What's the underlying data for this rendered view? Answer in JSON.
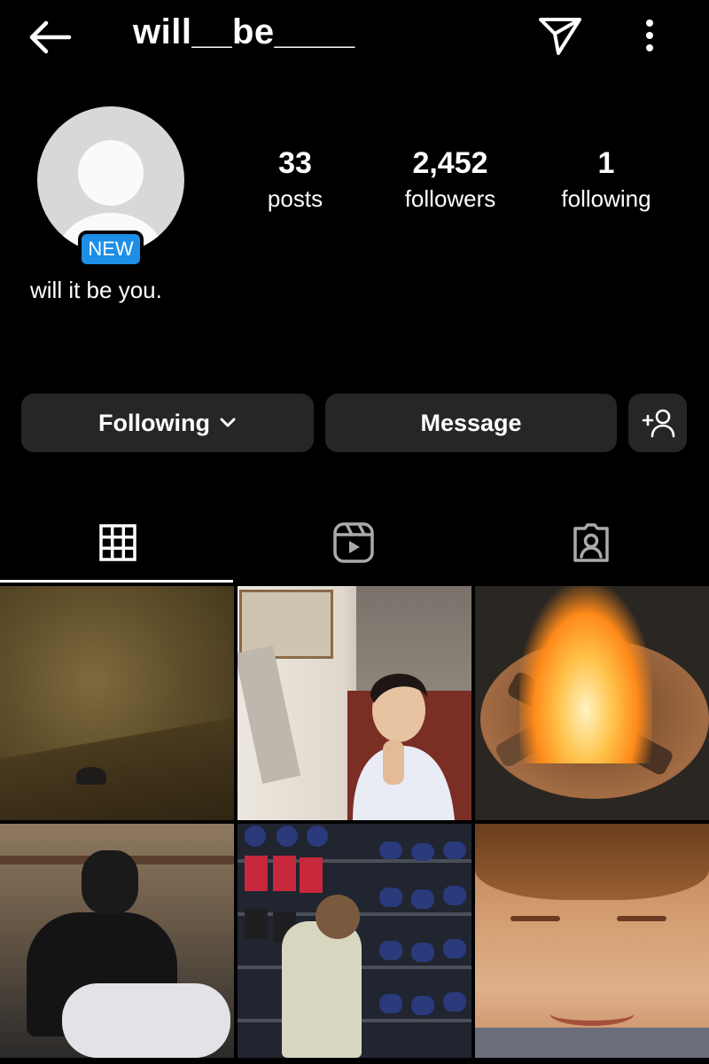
{
  "header": {
    "username": "will__be____",
    "icons": {
      "back": "back-arrow-icon",
      "send": "paper-plane-icon",
      "more": "more-vertical-icon"
    }
  },
  "profile": {
    "avatar": "default-avatar",
    "badge": "NEW",
    "bio": "will it be you.",
    "stats": {
      "posts": {
        "value": "33",
        "label": "posts"
      },
      "followers": {
        "value": "2,452",
        "label": "followers"
      },
      "following": {
        "value": "1",
        "label": "following"
      }
    }
  },
  "actions": {
    "following_label": "Following",
    "message_label": "Message",
    "add_user_icon": "add-user-icon"
  },
  "tabs": [
    {
      "name": "posts-grid",
      "icon": "grid-icon",
      "active": true
    },
    {
      "name": "reels",
      "icon": "reels-icon",
      "active": false
    },
    {
      "name": "tagged",
      "icon": "tagged-icon",
      "active": false
    }
  ],
  "colors": {
    "background": "#000000",
    "button": "#262626",
    "badge": "#1d8fe6"
  }
}
